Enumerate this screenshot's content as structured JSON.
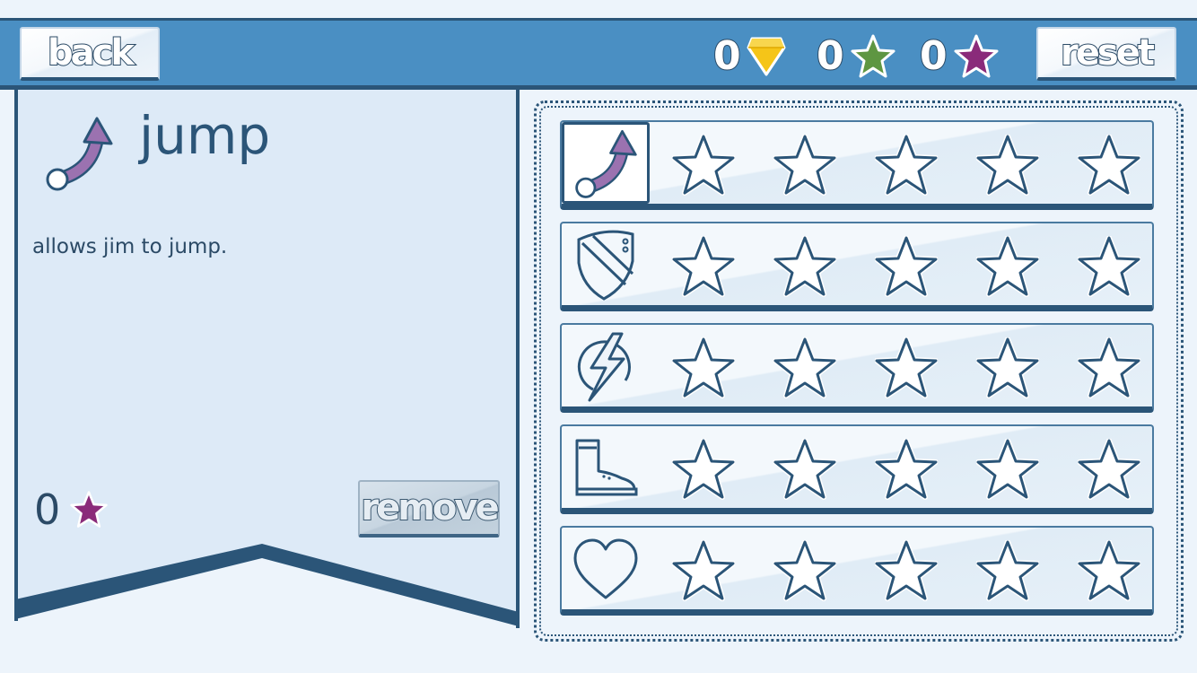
{
  "header": {
    "back_label": "back",
    "reset_label": "reset",
    "counters": [
      {
        "value": "0",
        "icon": "gem-icon",
        "color": "#f5c518"
      },
      {
        "value": "0",
        "icon": "green-star-icon",
        "color": "#5e9642"
      },
      {
        "value": "0",
        "icon": "purple-star-icon",
        "color": "#8a2b7a"
      }
    ]
  },
  "selected_skill": {
    "name": "jump",
    "description": "allows jim to jump.",
    "cost": "0",
    "cost_icon": "purple-star-icon",
    "remove_label": "remove"
  },
  "skills": [
    {
      "icon": "jump-arrow-icon",
      "selected": true,
      "slots": 5
    },
    {
      "icon": "shield-icon",
      "selected": false,
      "slots": 5
    },
    {
      "icon": "lightning-icon",
      "selected": false,
      "slots": 5
    },
    {
      "icon": "boot-icon",
      "selected": false,
      "slots": 5
    },
    {
      "icon": "heart-icon",
      "selected": false,
      "slots": 5
    }
  ],
  "colors": {
    "bar": "#4a8fc3",
    "dark": "#2b5578",
    "panel": "#ddeaf7",
    "background": "#edf4fb",
    "jump_arrow": "#9b72b0"
  }
}
